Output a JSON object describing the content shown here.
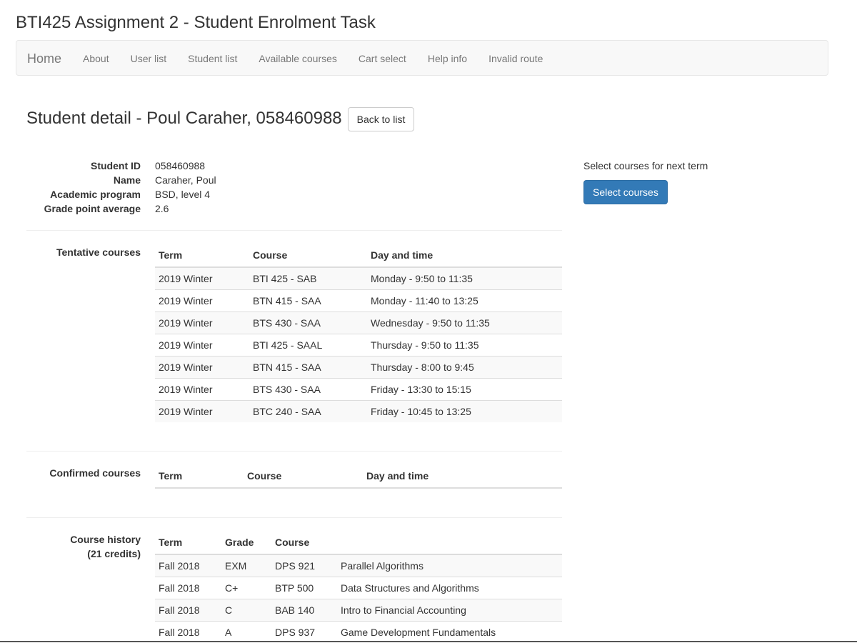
{
  "app": {
    "title": "BTI425 Assignment 2 - Student Enrolment Task"
  },
  "nav": {
    "brand": "Home",
    "links": [
      "About",
      "User list",
      "Student list",
      "Available courses",
      "Cart select",
      "Help info",
      "Invalid route"
    ]
  },
  "detail": {
    "heading": "Student detail - Poul Caraher, 058460988",
    "back_button": "Back to list"
  },
  "student": {
    "labels": {
      "id": "Student ID",
      "name": "Name",
      "program": "Academic program",
      "gpa": "Grade point average"
    },
    "id": "058460988",
    "name": "Caraher, Poul",
    "program": "BSD, level 4",
    "gpa": "2.6"
  },
  "select_panel": {
    "text": "Select courses for next term",
    "button": "Select courses"
  },
  "tentative": {
    "label": "Tentative courses",
    "headers": [
      "Term",
      "Course",
      "Day and time"
    ],
    "rows": [
      [
        "2019 Winter",
        "BTI 425 - SAB",
        "Monday - 9:50 to 11:35"
      ],
      [
        "2019 Winter",
        "BTN 415 - SAA",
        "Monday - 11:40 to 13:25"
      ],
      [
        "2019 Winter",
        "BTS 430 - SAA",
        "Wednesday - 9:50 to 11:35"
      ],
      [
        "2019 Winter",
        "BTI 425 - SAAL",
        "Thursday - 9:50 to 11:35"
      ],
      [
        "2019 Winter",
        "BTN 415 - SAA",
        "Thursday - 8:00 to 9:45"
      ],
      [
        "2019 Winter",
        "BTS 430 - SAA",
        "Friday - 13:30 to 15:15"
      ],
      [
        "2019 Winter",
        "BTC 240 - SAA",
        "Friday - 10:45 to 13:25"
      ]
    ]
  },
  "confirmed": {
    "label": "Confirmed courses",
    "headers": [
      "Term",
      "Course",
      "Day and time"
    ]
  },
  "history": {
    "label": "Course history",
    "credits": "(21 credits)",
    "headers": [
      "Term",
      "Grade",
      "Course",
      ""
    ],
    "rows": [
      [
        "Fall 2018",
        "EXM",
        "DPS 921",
        "Parallel Algorithms"
      ],
      [
        "Fall 2018",
        "C+",
        "BTP 500",
        "Data Structures and Algorithms"
      ],
      [
        "Fall 2018",
        "C",
        "BAB 140",
        "Intro to Financial Accounting"
      ],
      [
        "Fall 2018",
        "A",
        "DPS 937",
        "Game Development Fundamentals"
      ]
    ]
  }
}
